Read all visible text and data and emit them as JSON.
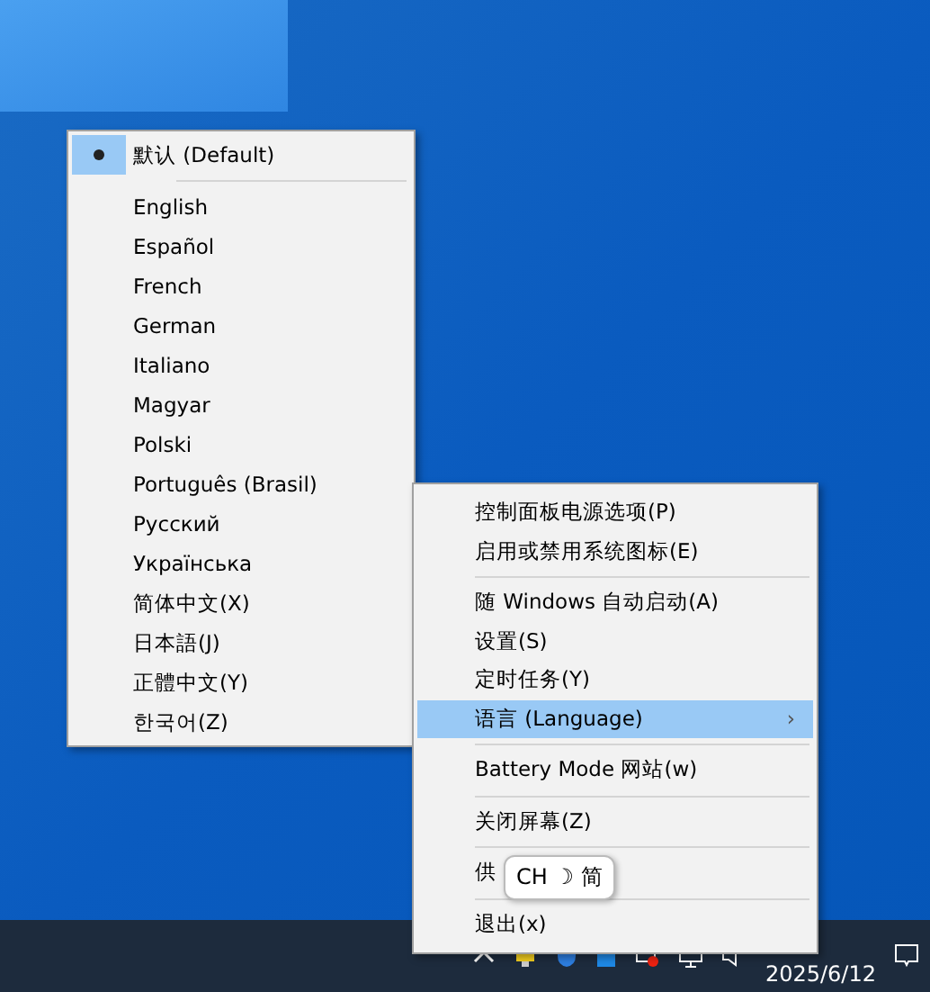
{
  "language_menu": {
    "items": [
      {
        "kind": "item",
        "label": "默认 (Default)",
        "selected": true
      },
      {
        "kind": "separator"
      },
      {
        "kind": "item",
        "label": "English",
        "selected": false
      },
      {
        "kind": "item",
        "label": "Español",
        "selected": false
      },
      {
        "kind": "item",
        "label": "French",
        "selected": false
      },
      {
        "kind": "item",
        "label": "German",
        "selected": false
      },
      {
        "kind": "item",
        "label": "Italiano",
        "selected": false
      },
      {
        "kind": "item",
        "label": "Magyar",
        "selected": false
      },
      {
        "kind": "item",
        "label": "Polski",
        "selected": false
      },
      {
        "kind": "item",
        "label": "Português (Brasil)",
        "selected": false
      },
      {
        "kind": "item",
        "label": "Русский",
        "selected": false
      },
      {
        "kind": "item",
        "label": "Українська",
        "selected": false
      },
      {
        "kind": "item",
        "label": "简体中文(X)",
        "selected": false
      },
      {
        "kind": "item",
        "label": "日本語(J)",
        "selected": false
      },
      {
        "kind": "item",
        "label": "正體中文(Y)",
        "selected": false
      },
      {
        "kind": "item",
        "label": "한국어(Z)",
        "selected": false
      }
    ]
  },
  "context_menu": {
    "items": [
      {
        "kind": "item",
        "label": "控制面板电源选项(P)",
        "highlighted": false,
        "submenu": false
      },
      {
        "kind": "item",
        "label": "启用或禁用系统图标(E)",
        "highlighted": false,
        "submenu": false
      },
      {
        "kind": "separator"
      },
      {
        "kind": "item",
        "label": "随 Windows 自动启动(A)",
        "highlighted": false,
        "submenu": false
      },
      {
        "kind": "item",
        "label": "设置(S)",
        "highlighted": false,
        "submenu": false
      },
      {
        "kind": "item",
        "label": "定时任务(Y)",
        "highlighted": false,
        "submenu": false
      },
      {
        "kind": "item",
        "label": "语言 (Language)",
        "highlighted": true,
        "submenu": true
      },
      {
        "kind": "separator"
      },
      {
        "kind": "item",
        "label": "Battery Mode 网站(w)",
        "highlighted": false,
        "submenu": false
      },
      {
        "kind": "separator"
      },
      {
        "kind": "item",
        "label": "关闭屏幕(Z)",
        "highlighted": false,
        "submenu": false
      },
      {
        "kind": "separator"
      },
      {
        "kind": "item",
        "label": "供",
        "highlighted": false,
        "submenu": false
      },
      {
        "kind": "separator"
      },
      {
        "kind": "item",
        "label": "退出(x)",
        "highlighted": false,
        "submenu": false
      }
    ]
  },
  "submenu_arrow": "›",
  "ime_tooltip": {
    "text": "CH ☽ 简"
  },
  "taskbar": {
    "date": "2025/6/12"
  }
}
